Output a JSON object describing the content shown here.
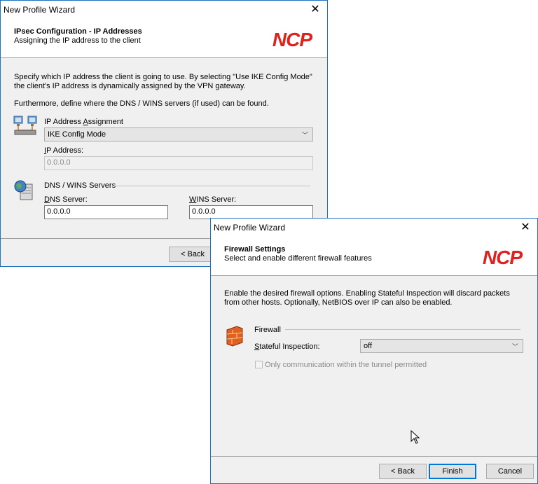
{
  "dialog1": {
    "window_title": "New Profile Wizard",
    "header_title": "IPsec Configuration - IP Addresses",
    "header_subtitle": "Assigning the IP address to the client",
    "logo": "NCP",
    "intro_line1": "Specify which IP address the client is going to use. By selecting \"Use IKE Config Mode\"",
    "intro_line2": "the client's IP address is dynamically assigned by the VPN gateway.",
    "intro_line3": "Furthermore, define where the DNS / WINS servers (if used) can be found.",
    "assignment_label_pre": "IP Address ",
    "assignment_label_ul": "A",
    "assignment_label_post": "ssignment",
    "assignment_value": "IKE Config Mode",
    "ip_label_ul": "I",
    "ip_label_post": "P Address:",
    "ip_value": "0.0.0.0",
    "dns_wins_group": "DNS / WINS Servers",
    "dns_label_ul": "D",
    "dns_label_post": "NS Server:",
    "dns_value": "0.0.0.0",
    "wins_label_ul": "W",
    "wins_label_post": "INS Server:",
    "wins_value": "0.0.0.0",
    "back_label": "< Back"
  },
  "dialog2": {
    "window_title": "New Profile Wizard",
    "header_title": "Firewall Settings",
    "header_subtitle": "Select and enable different firewall features",
    "logo": "NCP",
    "intro_line1": "Enable the desired firewall options.  Enabling Stateful Inspection will discard packets",
    "intro_line2": "from other hosts. Optionally, NetBIOS over IP can also be enabled.",
    "firewall_group": "Firewall",
    "stateful_label_ul": "S",
    "stateful_label_post": "tateful Inspection:",
    "stateful_value": "off",
    "tunnel_only_label": "Only communication within the tunnel permitted",
    "back_label": "< Back",
    "finish_label": "Finish",
    "cancel_label": "Cancel"
  },
  "icons": [
    "network-computers-icon",
    "server-globe-icon",
    "firewall-brick-icon",
    "mouse-cursor-icon"
  ]
}
